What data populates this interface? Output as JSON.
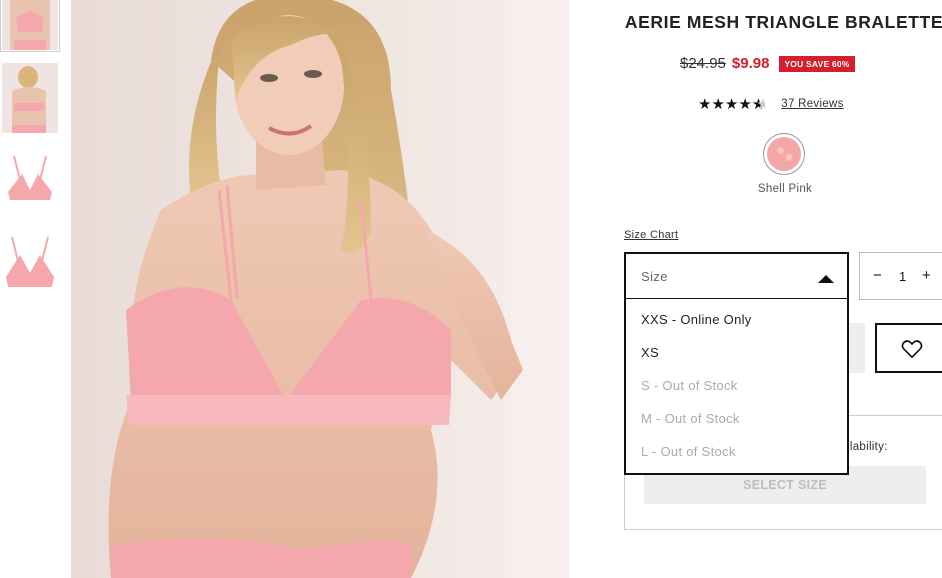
{
  "product": {
    "title": "AERIE MESH TRIANGLE BRALETTE",
    "original_price": "$24.95",
    "sale_price": "$9.98",
    "save_badge": "YOU SAVE 60%",
    "rating_value": 4.5,
    "stars_text": "★★★★★",
    "reviews_label": "37 Reviews",
    "color_name": "Shell Pink",
    "color_hex": "#f2a6a6"
  },
  "size": {
    "chart_link": "Size Chart",
    "placeholder": "Size",
    "options": [
      {
        "label": "XXS - Online Only",
        "available": true
      },
      {
        "label": "XS",
        "available": true
      },
      {
        "label": "S - Out of Stock",
        "available": false
      },
      {
        "label": "M - Out of Stock",
        "available": false
      },
      {
        "label": "L - Out of Stock",
        "available": false
      }
    ]
  },
  "quantity": {
    "minus": "−",
    "value": "1",
    "plus": "+"
  },
  "pickup": {
    "availability_text": "ilability:",
    "select_size_label": "SELECT SIZE"
  },
  "colors": {
    "sale_red": "#d2202f",
    "product_pink": "#f4a8ad"
  }
}
